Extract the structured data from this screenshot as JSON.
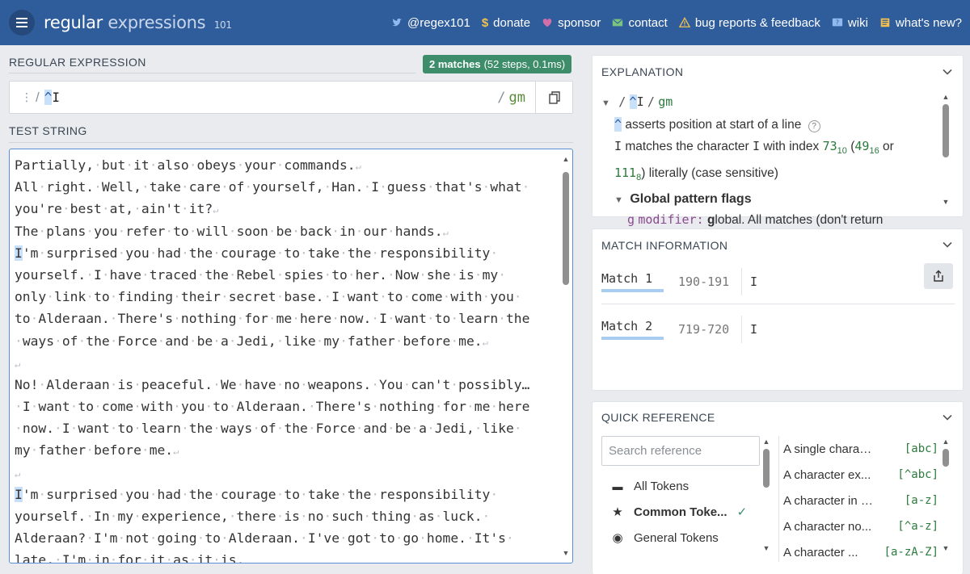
{
  "header": {
    "logo_main": "regular",
    "logo_sub": "expressions",
    "logo_version": "101",
    "nav": [
      {
        "label": "@regex101",
        "icon": "twitter-icon"
      },
      {
        "label": "donate",
        "icon": "dollar-icon"
      },
      {
        "label": "sponsor",
        "icon": "heart-icon"
      },
      {
        "label": "contact",
        "icon": "mail-icon"
      },
      {
        "label": "bug reports & feedback",
        "icon": "warning-icon"
      },
      {
        "label": "wiki",
        "icon": "help-icon"
      },
      {
        "label": "what's new?",
        "icon": "news-icon"
      }
    ]
  },
  "regex": {
    "section_title": "REGULAR EXPRESSION",
    "match_count": "2 matches",
    "match_detail": "(52 steps, 0.1ms)",
    "delimiter": "/",
    "pattern_caret": "^",
    "pattern_rest": "I",
    "flags": "gm"
  },
  "test": {
    "section_title": "TEST STRING",
    "lines": [
      {
        "text": "Partially,·but·it·also·obeys·your·commands.",
        "nl": true
      },
      {
        "text": "All·right.·Well,·take·care·of·yourself,·Han.·I·guess·that's·what·",
        "nl": false
      },
      {
        "text": "you're·best·at,·ain't·it?",
        "nl": true
      },
      {
        "text": "The·plans·you·refer·to·will·soon·be·back·in·our·hands.",
        "nl": true
      },
      {
        "match": "I",
        "text": "'m·surprised·you·had·the·courage·to·take·the·responsibility·",
        "nl": false
      },
      {
        "text": "yourself.·I·have·traced·the·Rebel·spies·to·her.·Now·she·is·my·",
        "nl": false
      },
      {
        "text": "only·link·to·finding·their·secret·base.·I·want·to·come·with·you·",
        "nl": false
      },
      {
        "text": "to·Alderaan.·There's·nothing·for·me·here·now.·I·want·to·learn·the",
        "nl": false
      },
      {
        "text": "·ways·of·the·Force·and·be·a·Jedi,·like·my·father·before·me.",
        "nl": true
      },
      {
        "text": "",
        "nl": true
      },
      {
        "text": "No!·Alderaan·is·peaceful.·We·have·no·weapons.·You·can't·possibly…",
        "nl": false
      },
      {
        "text": "·I·want·to·come·with·you·to·Alderaan.·There's·nothing·for·me·here",
        "nl": false
      },
      {
        "text": "·now.·I·want·to·learn·the·ways·of·the·Force·and·be·a·Jedi,·like·",
        "nl": false
      },
      {
        "text": "my·father·before·me.",
        "nl": true
      },
      {
        "text": "",
        "nl": true
      },
      {
        "match": "I",
        "text": "'m·surprised·you·had·the·courage·to·take·the·responsibility·",
        "nl": false
      },
      {
        "text": "yourself.·In·my·experience,·there·is·no·such·thing·as·luck.·",
        "nl": false
      },
      {
        "text": "Alderaan?·I'm·not·going·to·Alderaan.·I've·got·to·go·home.·It's·",
        "nl": false
      },
      {
        "text": "late,·I'm·in·for·it·as·it·is.",
        "nl": false
      }
    ]
  },
  "explanation": {
    "title": "EXPLANATION",
    "root_delim_open": "/",
    "root_caret": "^",
    "root_rest": "I",
    "root_delim_close": "/",
    "root_flags": "gm",
    "caret_token": "^",
    "caret_desc": "asserts position at start of a line",
    "char_token": "I",
    "char_desc_1": "matches the character",
    "char_desc_char": "I",
    "char_desc_2": "with index",
    "idx_dec": "73",
    "idx_dec_base": "10",
    "idx_hex": "49",
    "idx_hex_base": "16",
    "or_word": "or",
    "idx_oct": "111",
    "idx_oct_base": "8",
    "char_desc_3": "literally (case sensitive)",
    "flags_heading": "Global pattern flags",
    "g_flag": "g",
    "g_modifier": "modifier:",
    "g_desc_bold": "g",
    "g_desc": "lobal. All matches (don't return"
  },
  "match_info": {
    "title": "MATCH INFORMATION",
    "matches": [
      {
        "label": "Match 1",
        "range": "190-191",
        "value": "I"
      },
      {
        "label": "Match 2",
        "range": "719-720",
        "value": "I"
      }
    ]
  },
  "quick_ref": {
    "title": "QUICK REFERENCE",
    "search_placeholder": "Search reference",
    "categories": [
      {
        "label": "All Tokens",
        "icon": "stack-icon"
      },
      {
        "label": "Common Toke...",
        "icon": "star-icon",
        "selected": true
      },
      {
        "label": "General Tokens",
        "icon": "target-icon"
      }
    ],
    "items": [
      {
        "desc": "A single charact...",
        "token": "[abc]"
      },
      {
        "desc": "A character ex...",
        "token": "[^abc]"
      },
      {
        "desc": "A character in t...",
        "token": "[a-z]"
      },
      {
        "desc": "A character no...",
        "token": "[^a-z]"
      },
      {
        "desc": "A character ...",
        "token": "[a-zA-Z]"
      }
    ]
  }
}
